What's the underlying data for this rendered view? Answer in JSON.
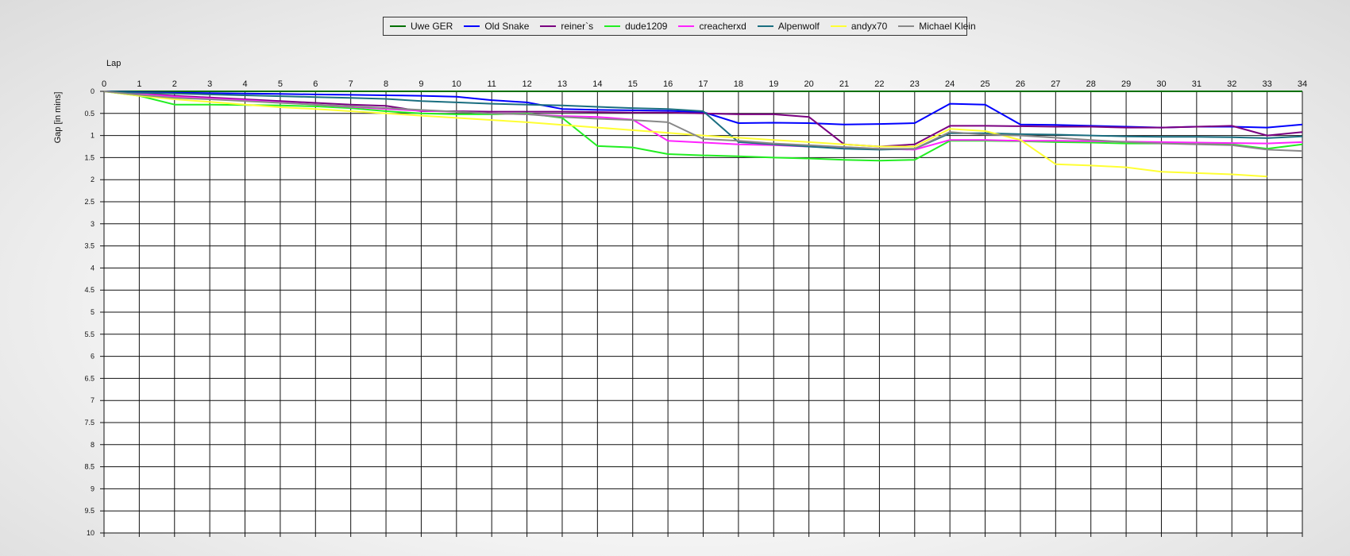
{
  "chart_data": {
    "type": "line",
    "xlabel": "Lap",
    "ylabel": "Gap [in mins]",
    "xlim": [
      0,
      34
    ],
    "ylim": [
      0,
      10
    ],
    "y_inverted": true,
    "grid": true,
    "legend_position": "top-center",
    "x_ticks": [
      "0",
      "1",
      "2",
      "3",
      "4",
      "5",
      "6",
      "7",
      "8",
      "9",
      "10",
      "11",
      "12",
      "13",
      "14",
      "15",
      "16",
      "17",
      "18",
      "19",
      "20",
      "21",
      "22",
      "23",
      "24",
      "25",
      "26",
      "27",
      "28",
      "29",
      "30",
      "31",
      "32",
      "33",
      "34"
    ],
    "y_ticks": [
      "0",
      "0.5",
      "1",
      "1.5",
      "2",
      "2.5",
      "3",
      "3.5",
      "4",
      "4.5",
      "5",
      "5.5",
      "6",
      "6.5",
      "7",
      "7.5",
      "8",
      "8.5",
      "9",
      "9.5",
      "10"
    ],
    "series": [
      {
        "name": "Uwe GER",
        "color": "#007000",
        "values": [
          0,
          0,
          0,
          0,
          0,
          0,
          0,
          0,
          0,
          0,
          0,
          0,
          0,
          0,
          0,
          0,
          0,
          0,
          0,
          0,
          0,
          0,
          0,
          0,
          0,
          0,
          0,
          0,
          0,
          0,
          0,
          0,
          0,
          0,
          0
        ]
      },
      {
        "name": "Old Snake",
        "color": "#0000ff",
        "values": [
          0,
          0.02,
          0.03,
          0.04,
          0.05,
          0.06,
          0.07,
          0.08,
          0.09,
          0.1,
          0.12,
          0.2,
          0.25,
          0.4,
          0.42,
          0.43,
          0.44,
          0.47,
          0.72,
          0.71,
          0.72,
          0.75,
          0.74,
          0.72,
          0.28,
          0.3,
          0.75,
          0.76,
          0.78,
          0.8,
          0.82,
          0.8,
          0.8,
          0.82,
          0.75
        ]
      },
      {
        "name": "reiner`s",
        "color": "#7a0080",
        "values": [
          0,
          0.05,
          0.1,
          0.14,
          0.18,
          0.22,
          0.26,
          0.3,
          0.33,
          0.45,
          0.45,
          0.46,
          0.46,
          0.46,
          0.47,
          0.48,
          0.48,
          0.5,
          0.52,
          0.52,
          0.58,
          1.2,
          1.25,
          1.2,
          0.78,
          0.78,
          0.79,
          0.8,
          0.8,
          0.82,
          0.82,
          0.8,
          0.78,
          1.0,
          0.92
        ]
      },
      {
        "name": "dude1209",
        "color": "#22ee22",
        "values": [
          0,
          0.1,
          0.3,
          0.3,
          0.31,
          0.32,
          0.34,
          0.38,
          0.45,
          0.5,
          0.52,
          0.52,
          0.5,
          0.6,
          1.24,
          1.27,
          1.42,
          1.45,
          1.47,
          1.5,
          1.52,
          1.55,
          1.57,
          1.55,
          1.12,
          1.12,
          1.13,
          1.15,
          1.16,
          1.18,
          1.18,
          1.18,
          1.2,
          1.3,
          1.2
        ]
      },
      {
        "name": "creacherxd",
        "color": "#ff22ff",
        "values": [
          0,
          0.06,
          0.12,
          0.16,
          0.2,
          0.25,
          0.3,
          0.35,
          0.4,
          0.44,
          0.46,
          0.5,
          0.52,
          0.56,
          0.58,
          0.64,
          1.12,
          1.16,
          1.2,
          1.22,
          1.25,
          1.28,
          1.3,
          1.32,
          1.1,
          1.1,
          1.12,
          1.12,
          1.13,
          1.14,
          1.15,
          1.16,
          1.17,
          1.18,
          1.15
        ]
      },
      {
        "name": "Alpenwolf",
        "color": "#1a6e80",
        "values": [
          0,
          0.03,
          0.05,
          0.07,
          0.09,
          0.11,
          0.13,
          0.15,
          0.17,
          0.22,
          0.25,
          0.28,
          0.3,
          0.32,
          0.35,
          0.38,
          0.4,
          0.45,
          1.15,
          1.2,
          1.25,
          1.3,
          1.32,
          1.3,
          0.95,
          0.95,
          0.97,
          0.98,
          1.0,
          1.02,
          1.03,
          1.03,
          1.04,
          1.06,
          1.02
        ]
      },
      {
        "name": "andyx70",
        "color": "#ffff33",
        "values": [
          0,
          0.1,
          0.18,
          0.24,
          0.3,
          0.36,
          0.4,
          0.45,
          0.5,
          0.55,
          0.6,
          0.65,
          0.7,
          0.76,
          0.82,
          0.88,
          0.94,
          1.0,
          1.05,
          1.1,
          1.15,
          1.2,
          1.25,
          1.25,
          0.85,
          0.9,
          1.1,
          1.65,
          1.68,
          1.72,
          1.82,
          1.85,
          1.88,
          1.93,
          null
        ]
      },
      {
        "name": "Michael Klein",
        "color": "#888888",
        "values": [
          0,
          0.08,
          0.15,
          0.18,
          0.22,
          0.26,
          0.3,
          0.34,
          0.38,
          0.42,
          0.46,
          0.5,
          0.52,
          0.58,
          0.62,
          0.65,
          0.7,
          1.08,
          1.12,
          1.18,
          1.22,
          1.26,
          1.3,
          1.3,
          0.92,
          0.98,
          1.0,
          1.05,
          1.1,
          1.15,
          1.18,
          1.2,
          1.22,
          1.32,
          1.35
        ]
      }
    ]
  }
}
